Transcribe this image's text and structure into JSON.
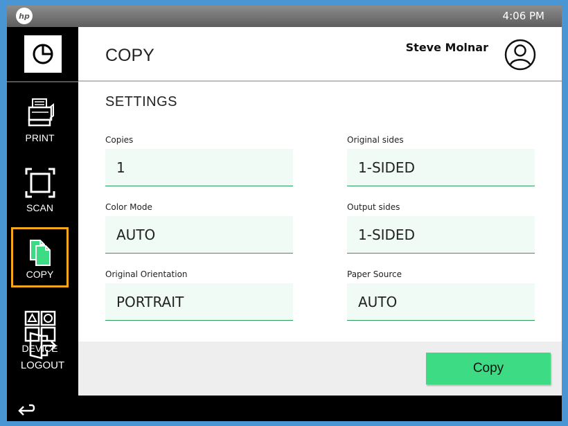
{
  "status_bar": {
    "logo": "hp",
    "time": "4:06 PM"
  },
  "sidebar": {
    "items": [
      {
        "label": "PRINT",
        "icon": "printer-icon"
      },
      {
        "label": "SCAN",
        "icon": "scan-frame-icon"
      },
      {
        "label": "COPY",
        "icon": "copy-documents-icon",
        "selected": true
      },
      {
        "label": "DEVICE",
        "icon": "device-apps-icon"
      }
    ],
    "logout_label": "LOGOUT"
  },
  "header": {
    "title": "COPY",
    "user_name": "Steve Molnar"
  },
  "settings": {
    "title": "SETTINGS",
    "fields": [
      {
        "label": "Copies",
        "value": "1"
      },
      {
        "label": "Original sides",
        "value": "1-SIDED"
      },
      {
        "label": "Color Mode",
        "value": "AUTO"
      },
      {
        "label": "Output sides",
        "value": "1-SIDED"
      },
      {
        "label": "Original Orientation",
        "value": "PORTRAIT"
      },
      {
        "label": "Paper Source",
        "value": "AUTO"
      }
    ]
  },
  "actions": {
    "copy_label": "Copy"
  },
  "colors": {
    "accent_green": "#3ddc84",
    "field_bg": "#f0fbf5",
    "selected_outline": "#f7a81b",
    "page_bg": "#4a96d4"
  }
}
